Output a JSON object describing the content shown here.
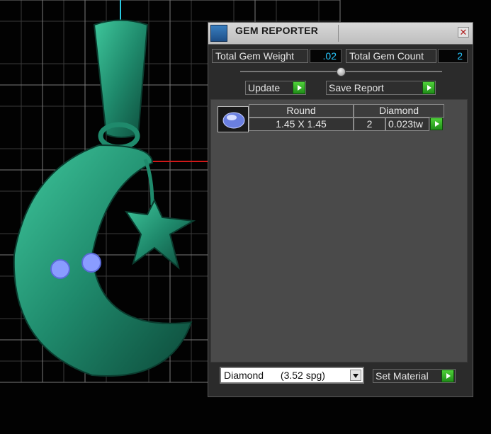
{
  "panel": {
    "title": "GEM REPORTER",
    "title_icon": "gem-reporter-icon",
    "close_icon": "close-icon",
    "close_glyph": "✕"
  },
  "summary": {
    "weight_label": "Total Gem Weight",
    "weight_value": ".02",
    "count_label": "Total Gem Count",
    "count_value": "2",
    "value_color": "#28c8ff"
  },
  "slider": {
    "level": 0.5
  },
  "actions": {
    "update_label": "Update",
    "save_report_label": "Save Report"
  },
  "gem_row": {
    "shape": "Round",
    "material": "Diamond",
    "size": "1.45 X 1.45",
    "count": "2",
    "weight": "0.023tw",
    "thumb_icon": "round-gem-icon"
  },
  "material_select": {
    "selected": "Diamond",
    "density": "(3.52 spg)"
  },
  "set_material_label": "Set Material",
  "colors": {
    "model_green": "#1f8a6c",
    "gem_blue": "#8a9cff",
    "button_green": "#3bbd2c",
    "axis_red": "#d01818",
    "axis_cyan": "#28c8e0"
  }
}
